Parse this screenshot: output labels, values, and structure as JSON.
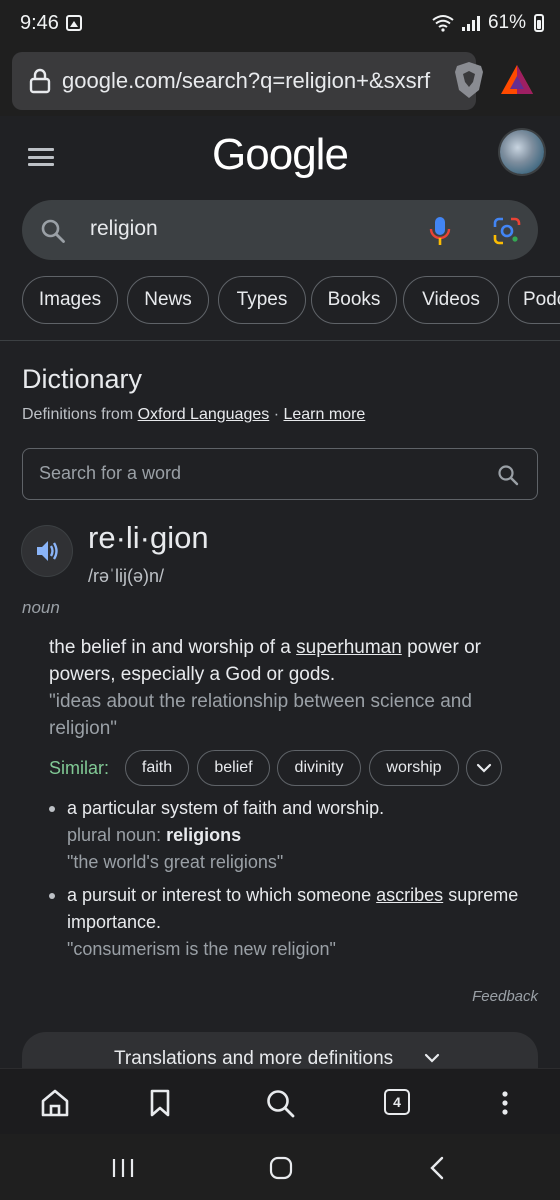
{
  "status_bar": {
    "time": "9:46",
    "battery": "61%"
  },
  "browser": {
    "url": "google.com/search?q=religion+&sxsrf"
  },
  "header": {
    "logo": "Google"
  },
  "search": {
    "query": "religion"
  },
  "chips": [
    "Images",
    "News",
    "Types",
    "Books",
    "Videos",
    "Podc"
  ],
  "dictionary": {
    "title": "Dictionary",
    "source_prefix": "Definitions from ",
    "source_name": "Oxford Languages",
    "source_sep": " · ",
    "learn_more": "Learn more",
    "word_search_placeholder": "Search for a word",
    "headword": "re·li·gion",
    "phonetic": "/rəˈlij(ə)n/",
    "part_of_speech": "noun",
    "def1_pre": "the belief in and worship of a ",
    "def1_link": "superhuman",
    "def1_post": " power or powers, especially a God or gods.",
    "def1_example": "\"ideas about the relationship between science and religion\"",
    "similar_label": "Similar:",
    "synonyms": [
      "faith",
      "belief",
      "divinity",
      "worship"
    ],
    "def2_text": "a particular system of faith and worship.",
    "def2_plural_label": "plural noun: ",
    "def2_plural_value": "religions",
    "def2_example": "\"the world's great religions\"",
    "def3_pre": "a pursuit or interest to which someone ",
    "def3_link": "ascribes",
    "def3_post": " supreme importance.",
    "def3_example": "\"consumerism is the new religion\"",
    "feedback": "Feedback",
    "more_label": "Translations and more definitions"
  },
  "bottom_nav": {
    "tab_count": "4"
  }
}
